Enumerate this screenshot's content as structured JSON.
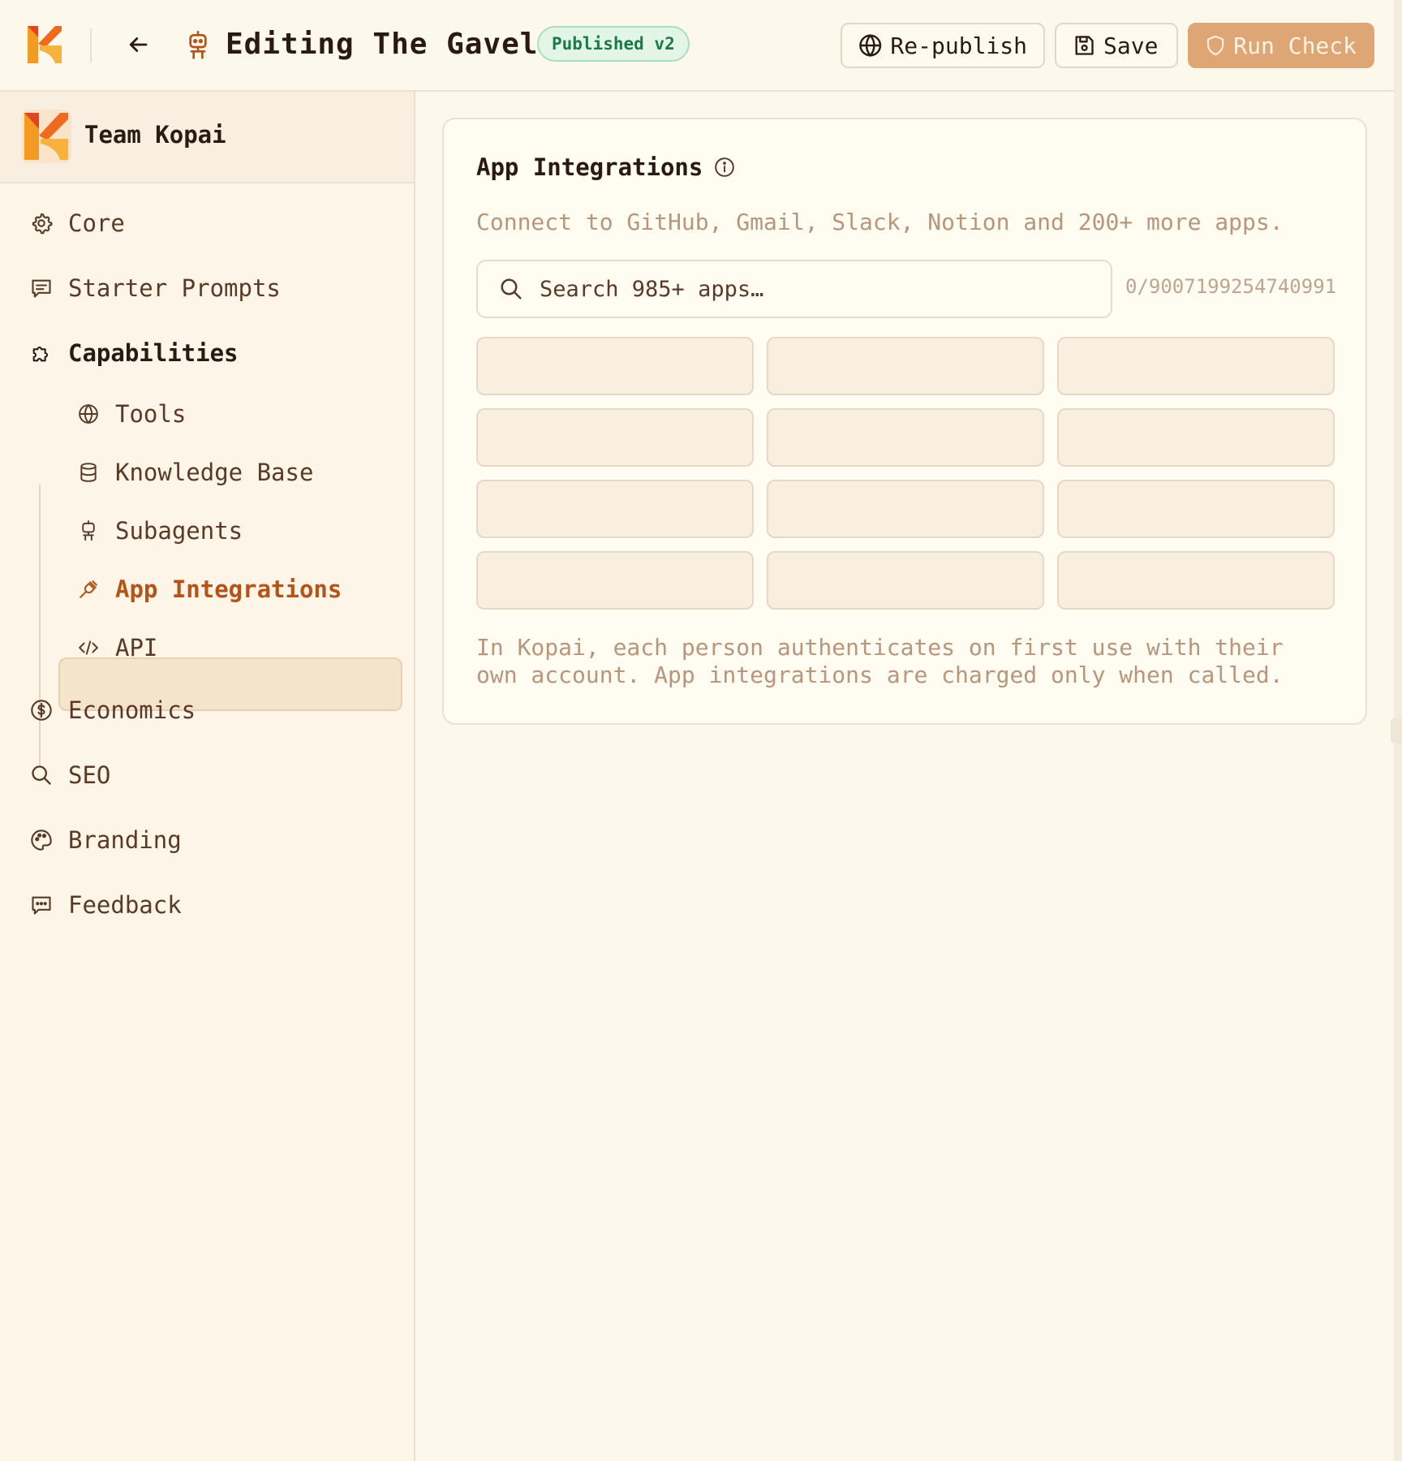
{
  "header": {
    "title": "Editing The Gavel",
    "status_badge": "Published v2",
    "republish_label": "Re-publish",
    "save_label": "Save",
    "run_check_label": "Run Check"
  },
  "sidebar": {
    "team_name": "Team Kopai",
    "items": [
      {
        "label": "Core",
        "icon": "gear-icon"
      },
      {
        "label": "Starter Prompts",
        "icon": "message-square-icon"
      },
      {
        "label": "Capabilities",
        "icon": "puzzle-icon"
      },
      {
        "label": "Tools",
        "icon": "globe-icon"
      },
      {
        "label": "Knowledge Base",
        "icon": "database-icon"
      },
      {
        "label": "Subagents",
        "icon": "robot-icon"
      },
      {
        "label": "App Integrations",
        "icon": "plug-icon",
        "active": true
      },
      {
        "label": "API",
        "icon": "code-icon"
      },
      {
        "label": "Economics",
        "icon": "dollar-circle-icon"
      },
      {
        "label": "SEO",
        "icon": "search-icon"
      },
      {
        "label": "Branding",
        "icon": "palette-icon"
      },
      {
        "label": "Feedback",
        "icon": "message-dots-icon"
      }
    ]
  },
  "main": {
    "card_title": "App Integrations",
    "description": "Connect to GitHub, Gmail, Slack, Notion and 200+ more apps.",
    "search_placeholder": "Search 985+ apps…",
    "search_value": "",
    "counter": "0/9007199254740991",
    "footer_text": "In Kopai, each person authenticates on first use with their own account. App integrations are charged only when called."
  },
  "colors": {
    "background": "#fdf8ec",
    "accent": "#b55418",
    "run_check_button": "#dea575",
    "badge_green": "#1b7a45"
  }
}
